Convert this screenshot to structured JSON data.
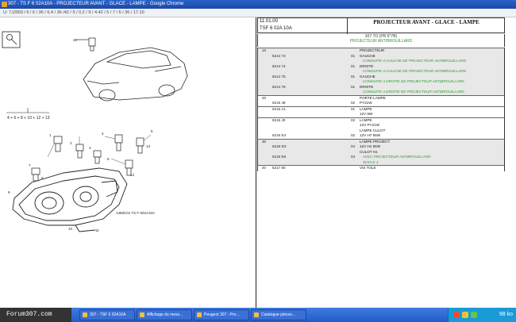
{
  "window": {
    "title": "307 - TS F 6 02A10A - PROJECTEUR AVANT - GLACE - LAMPE - Google Chrome",
    "address": "U: 7JJ003 / 6 / 6 / 36 / 6.4 / 36 /42 / 5 / 0.2 / 9 / 4.42 / 5 / 7 / 6 / 36 / 17.10"
  },
  "diagram": {
    "ref_text": "1458C01 TS F 602A10A",
    "index_row": "4 + 6 + 8 + 10 + 12 + 13",
    "callouts": [
      "30",
      "1",
      "2",
      "3",
      "4",
      "5",
      "6",
      "7",
      "8",
      "9",
      "10",
      "11",
      "12",
      "13"
    ]
  },
  "parts_sheet": {
    "ref_number": "11.01.00",
    "ref_code": "TSF 6 02A 10A",
    "title": "PROJECTEUR AVANT - GLACE - LAMPE",
    "subheader_line1": "307 TO (PR 5*7B)",
    "subheader_line2": "PROJECTEUR ANTIBROUILLARD",
    "rows": [
      {
        "shaded": true,
        "lines": [
          {
            "num": "10",
            "ref": "",
            "qty": "",
            "desc": "PROJECTEUR",
            "note": ""
          },
          {
            "num": "",
            "ref": "6214 73",
            "qty": "01",
            "desc": "GAUCHE",
            "note": ""
          },
          {
            "num": "",
            "ref": "",
            "qty": "",
            "desc": "",
            "note": "CONDUITE A GAUCHE DE PROJECTEUR ANTIBROUILLARD"
          },
          {
            "num": "",
            "ref": "6214 74",
            "qty": "01",
            "desc": "DROITE",
            "note": ""
          },
          {
            "num": "",
            "ref": "",
            "qty": "",
            "desc": "",
            "note": "CONDUITE A GAUCHE DE PROJECTEUR ANTIBROUILLARD"
          },
          {
            "num": "",
            "ref": "6214 75",
            "qty": "01",
            "desc": "GAUCHE",
            "note": ""
          },
          {
            "num": "",
            "ref": "",
            "qty": "",
            "desc": "",
            "note": "CONDUITE A DROITE DE PROJECTEUR ANTIBROUILLARD"
          },
          {
            "num": "",
            "ref": "6214 76",
            "qty": "01",
            "desc": "DROITE",
            "note": ""
          },
          {
            "num": "",
            "ref": "",
            "qty": "",
            "desc": "",
            "note": "CONDUITE A DROITE DE PROJECTEUR ANTIBROUILLARD"
          }
        ]
      },
      {
        "shaded": false,
        "lines": [
          {
            "num": "20",
            "ref": "",
            "qty": "",
            "desc": "PORTE-LAMPE",
            "note": ""
          },
          {
            "num": "",
            "ref": "6216 48",
            "qty": "02",
            "desc": "PY21W",
            "note": ""
          }
        ]
      },
      {
        "shaded": false,
        "lines": [
          {
            "num": "",
            "ref": "6216 A1",
            "qty": "01",
            "desc": "LAMPE",
            "note": ""
          },
          {
            "num": "",
            "ref": "",
            "qty": "",
            "desc": "12V 5W",
            "note": ""
          }
        ]
      },
      {
        "shaded": false,
        "lines": [
          {
            "num": "",
            "ref": "6216 J0",
            "qty": "02",
            "desc": "LAMPE",
            "note": ""
          },
          {
            "num": "",
            "ref": "",
            "qty": "",
            "desc": "12V PY21W",
            "note": ""
          },
          {
            "num": "",
            "ref": "",
            "qty": "",
            "desc": "LAMPE CULOT",
            "note": ""
          },
          {
            "num": "",
            "ref": "6216 E4",
            "qty": "02",
            "desc": "12V H7 55W",
            "note": ""
          }
        ]
      },
      {
        "shaded": true,
        "lines": [
          {
            "num": "30",
            "ref": "",
            "qty": "",
            "desc": "LAMPE PROJECT",
            "note": ""
          },
          {
            "num": "",
            "ref": "6216 D3",
            "qty": "04",
            "desc": "12V H1 55W",
            "note": ""
          },
          {
            "num": "",
            "ref": "",
            "qty": "",
            "desc": "CULOT H1",
            "note": ""
          },
          {
            "num": "",
            "ref": "6216 E6",
            "qty": "04",
            "desc": "",
            "note": "AVEC PROJECTEUR ANTIBROUILLARD"
          },
          {
            "num": "",
            "ref": "",
            "qty": "",
            "desc": "",
            "note": "SOCLE 1"
          }
        ]
      },
      {
        "shaded": false,
        "lines": [
          {
            "num": "40",
            "ref": "6217 80",
            "qty": "",
            "desc": "VIS TOLE",
            "note": ""
          }
        ]
      }
    ]
  },
  "taskbar": {
    "start_label": "Forum307.com",
    "tasks": [
      "307 - TSF 6 02A10A",
      "Affichage du mess...",
      "Peugeot 307 : Pro...",
      "Catalogue pièces..."
    ],
    "clock": "98 ko"
  }
}
